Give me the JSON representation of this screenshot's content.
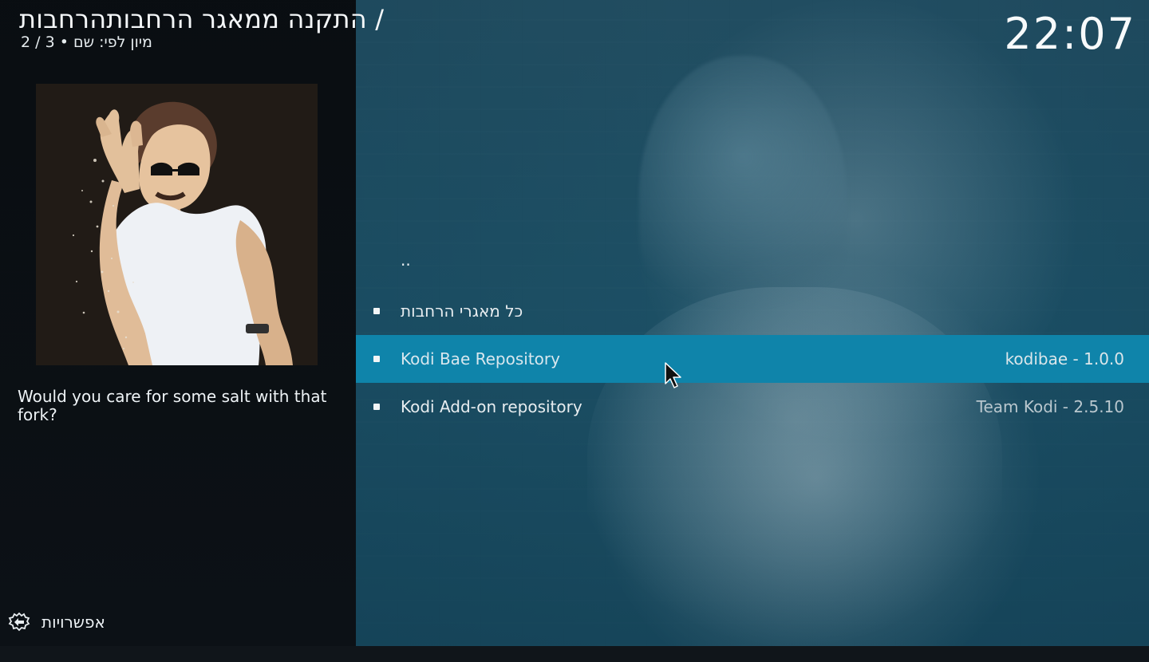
{
  "header": {
    "title": "התקנה ממאגר הרחבותהרחבות /",
    "subtitle": "מיון לפי: שם  •  3 / 2",
    "clock": "22:07"
  },
  "sidebar": {
    "description": "Would you care for some salt with that fork?",
    "options_label": "אפשרויות"
  },
  "list": {
    "items": [
      {
        "label": "..",
        "right": ""
      },
      {
        "label": "כל מאגרי הרחבות",
        "right": ""
      },
      {
        "label": "Kodi Bae Repository",
        "right": "kodibae - 1.0.0",
        "selected": true
      },
      {
        "label": "Kodi Add-on repository",
        "right": "Team Kodi - 2.5.10"
      }
    ]
  },
  "colors": {
    "selected_row": "#0f84aa",
    "fanart_tint": "#2c596e"
  },
  "icons": {
    "options": "options-icon",
    "cursor": "mouse-pointer-icon"
  }
}
